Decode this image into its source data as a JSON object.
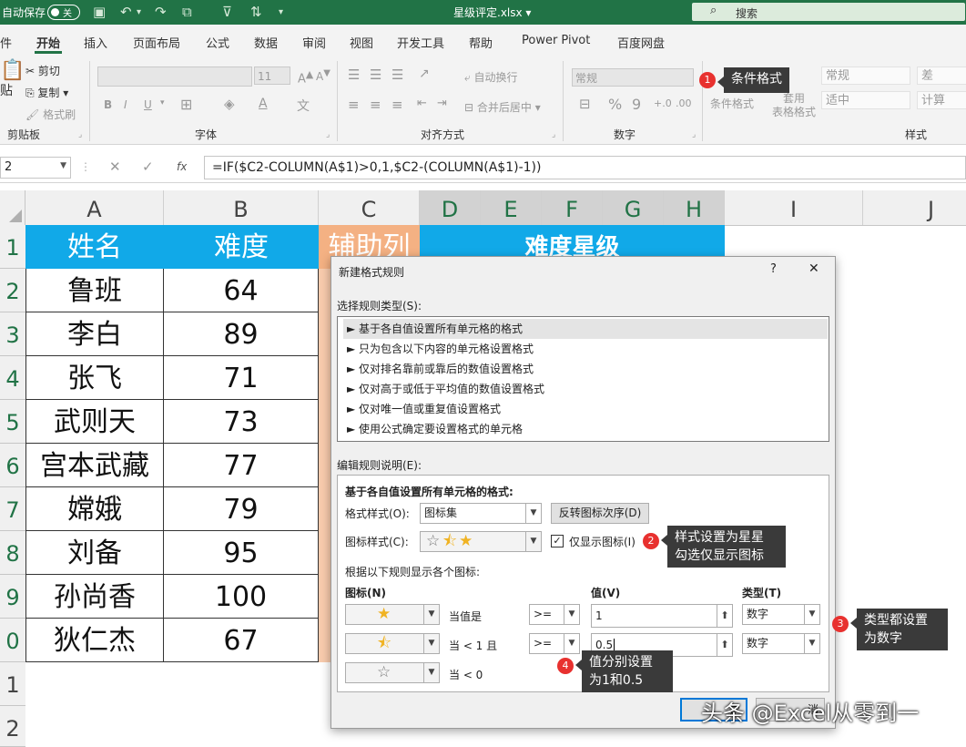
{
  "titlebar": {
    "autosave_label": "自动保存",
    "autosave_state": "关",
    "document_title": "星级评定.xlsx",
    "search_placeholder": "搜索"
  },
  "ribbon_tabs": [
    "件",
    "开始",
    "插入",
    "页面布局",
    "公式",
    "数据",
    "审阅",
    "视图",
    "开发工具",
    "帮助",
    "Power Pivot",
    "百度网盘"
  ],
  "active_tab": "开始",
  "ribbon": {
    "clipboard": {
      "paste": "贴",
      "cut": "剪切",
      "copy": "复制",
      "format_painter": "格式刷",
      "group": "剪贴板"
    },
    "font": {
      "font_size": "11",
      "bold": "B",
      "italic": "I",
      "underline": "U",
      "font_color": "A",
      "group": "字体"
    },
    "alignment": {
      "wrap": "自动换行",
      "merge": "合并后居中",
      "group": "对齐方式"
    },
    "number": {
      "format": "常规",
      "percent": "%",
      "comma": "9",
      "group": "数字"
    },
    "styles": {
      "conditional": "条件格式",
      "table_format": "套用\n表格格式",
      "cells": [
        "常规",
        "差",
        "适中",
        "计算"
      ],
      "group": "样式"
    }
  },
  "formula_bar": {
    "name_box": "2",
    "fx": "fx",
    "formula": "=IF($C2-COLUMN(A$1)>0,1,$C2-(COLUMN(A$1)-1))"
  },
  "sheet": {
    "columns": [
      "A",
      "B",
      "C",
      "D",
      "E",
      "F",
      "G",
      "H",
      "I",
      "J"
    ],
    "selected_columns": [
      "D",
      "E",
      "F",
      "G",
      "H"
    ],
    "row_numbers": [
      "1",
      "2",
      "3",
      "4",
      "5",
      "6",
      "7",
      "8",
      "9",
      "0",
      "1",
      "2"
    ],
    "headers": {
      "name": "姓名",
      "difficulty": "难度",
      "helper": "辅助列",
      "stars": "难度星级"
    },
    "rows": [
      {
        "name": "鲁班",
        "difficulty": "64"
      },
      {
        "name": "李白",
        "difficulty": "89"
      },
      {
        "name": "张飞",
        "difficulty": "71"
      },
      {
        "name": "武则天",
        "difficulty": "73"
      },
      {
        "name": "宫本武藏",
        "difficulty": "77"
      },
      {
        "name": "嫦娥",
        "difficulty": "79"
      },
      {
        "name": "刘备",
        "difficulty": "95"
      },
      {
        "name": "孙尚香",
        "difficulty": "100"
      },
      {
        "name": "狄仁杰",
        "difficulty": "67"
      }
    ]
  },
  "dialog": {
    "title": "新建格式规则",
    "help": "?",
    "close": "✕",
    "select_rule_type_label": "选择规则类型(S):",
    "rule_types": [
      "► 基于各自值设置所有单元格的格式",
      "► 只为包含以下内容的单元格设置格式",
      "► 仅对排名靠前或靠后的数值设置格式",
      "► 仅对高于或低于平均值的数值设置格式",
      "► 仅对唯一值或重复值设置格式",
      "► 使用公式确定要设置格式的单元格"
    ],
    "edit_rule_label": "编辑规则说明(E):",
    "edit_heading": "基于各自值设置所有单元格的格式:",
    "format_style_label": "格式样式(O):",
    "format_style_value": "图标集",
    "reverse_button": "反转图标次序(D)",
    "icon_style_label": "图标样式(C):",
    "show_icon_only_label": "仅显示图标(I)",
    "show_icon_only_checked": true,
    "rules_caption": "根据以下规则显示各个图标:",
    "col_icon": "图标(N)",
    "col_value": "值(V)",
    "col_type": "类型(T)",
    "rules": [
      {
        "condition": "当值是",
        "operator": ">=",
        "value": "1",
        "type": "数字",
        "fill": "full"
      },
      {
        "condition": "当 < 1 且",
        "operator": ">=",
        "value": "0.5",
        "type": "数字",
        "fill": "half"
      },
      {
        "condition": "当 < 0",
        "fill": "empty"
      }
    ],
    "ok_partial": "定",
    "cancel_partial": "消"
  },
  "callouts": [
    {
      "num": "1",
      "text": "条件格式"
    },
    {
      "num": "2",
      "text": "样式设置为星星\n勾选仅显示图标"
    },
    {
      "num": "3",
      "text": "类型都设置\n为数字"
    },
    {
      "num": "4",
      "text": "值分别设置\n为1和0.5"
    }
  ],
  "watermark": "头条 @Excel从零到一",
  "colors": {
    "excel_green": "#217346",
    "header_blue": "#11a9e8",
    "helper_orange": "#f4b183",
    "star_gold": "#f0b323"
  }
}
